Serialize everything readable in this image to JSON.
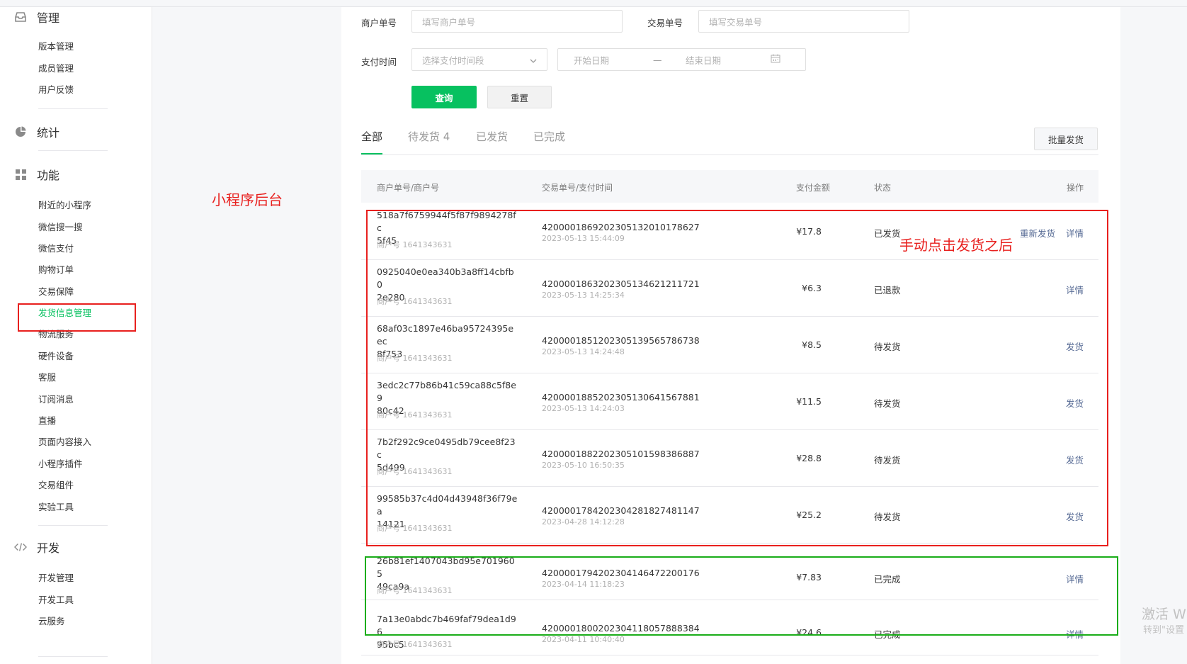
{
  "sidebar": {
    "sections": [
      {
        "title": "管理",
        "icon": "inbox-icon"
      },
      {
        "title": "统计",
        "icon": "pie-chart-icon"
      },
      {
        "title": "功能",
        "icon": "grid-icon"
      },
      {
        "title": "开发",
        "icon": "code-icon"
      }
    ],
    "manage_items": [
      "版本管理",
      "成员管理",
      "用户反馈"
    ],
    "function_items": [
      "附近的小程序",
      "微信搜一搜",
      "微信支付",
      "购物订单",
      "交易保障",
      "发货信息管理",
      "物流服务",
      "硬件设备",
      "客服",
      "订阅消息",
      "直播",
      "页面内容接入",
      "小程序插件",
      "交易组件",
      "实验工具"
    ],
    "dev_items": [
      "开发管理",
      "开发工具",
      "云服务"
    ],
    "active_item": "发货信息管理"
  },
  "filters": {
    "merchant_no_label": "商户单号",
    "merchant_no_placeholder": "填写商户单号",
    "trade_no_label": "交易单号",
    "trade_no_placeholder": "填写交易单号",
    "pay_time_label": "支付时间",
    "pay_time_placeholder": "选择支付时间段",
    "start_date": "开始日期",
    "date_sep": "—",
    "end_date": "结束日期",
    "query_button": "查询",
    "reset_button": "重置"
  },
  "tabs": [
    {
      "label": "全部",
      "active": true
    },
    {
      "label": "待发货 4",
      "active": false
    },
    {
      "label": "已发货",
      "active": false
    },
    {
      "label": "已完成",
      "active": false
    }
  ],
  "batch_ship_button": "批量发货",
  "table": {
    "headers": [
      "商户单号/商户号",
      "交易单号/支付时间",
      "支付金额",
      "状态",
      "操作"
    ],
    "rows": [
      {
        "order_line1": "518a7f6759944f5f87f9894278fc",
        "order_line2": "5f45",
        "merchant": "商户号 1641343631",
        "trade_no": "4200001869202305132010178627",
        "pay_time": "2023-05-13 15:44:09",
        "amount": "¥17.8",
        "status": "已发货",
        "actions": [
          "重新发货",
          "详情"
        ]
      },
      {
        "order_line1": "0925040e0ea340b3a8ff14cbfb0",
        "order_line2": "2e280",
        "merchant": "商户号 1641343631",
        "trade_no": "4200001863202305134621211721",
        "pay_time": "2023-05-13 14:25:34",
        "amount": "¥6.3",
        "status": "已退款",
        "actions": [
          "详情"
        ]
      },
      {
        "order_line1": "68af03c1897e46ba95724395eec",
        "order_line2": "8f753",
        "merchant": "商户号 1641343631",
        "trade_no": "4200001851202305139565786738",
        "pay_time": "2023-05-13 14:24:48",
        "amount": "¥8.5",
        "status": "待发货",
        "actions": [
          "发货"
        ]
      },
      {
        "order_line1": "3edc2c77b86b41c59ca88c5f8e9",
        "order_line2": "80c42",
        "merchant": "商户号 1641343631",
        "trade_no": "4200001885202305130641567881",
        "pay_time": "2023-05-13 14:24:03",
        "amount": "¥11.5",
        "status": "待发货",
        "actions": [
          "发货"
        ]
      },
      {
        "order_line1": "7b2f292c9ce0495db79cee8f23c",
        "order_line2": "5d499",
        "merchant": "商户号 1641343631",
        "trade_no": "4200001882202305101598386887",
        "pay_time": "2023-05-10 16:50:35",
        "amount": "¥28.8",
        "status": "待发货",
        "actions": [
          "发货"
        ]
      },
      {
        "order_line1": "99585b37c4d04d43948f36f79ea",
        "order_line2": "14121",
        "merchant": "商户号 1641343631",
        "trade_no": "4200001784202304281827481147",
        "pay_time": "2023-04-28 14:12:28",
        "amount": "¥25.2",
        "status": "待发货",
        "actions": [
          "发货"
        ]
      },
      {
        "order_line1": "26b81ef1407043bd95e7019605",
        "order_line2": "49ca9a",
        "merchant": "商户号 1641343631",
        "trade_no": "4200001794202304146472200176",
        "pay_time": "2023-04-14 11:18:23",
        "amount": "¥7.83",
        "status": "已完成",
        "actions": [
          "详情"
        ]
      },
      {
        "order_line1": "7a13e0abdc7b469faf79dea1d96",
        "order_line2": "95bc5",
        "merchant": "商户号 1641343631",
        "trade_no": "4200001800202304118057888384",
        "pay_time": "2023-04-11 10:40:40",
        "amount": "¥24.6",
        "status": "已完成",
        "actions": [
          "详情"
        ]
      }
    ]
  },
  "annotations": {
    "label_backend": "小程序后台",
    "label_after_ship": "手动点击发货之后",
    "highlight_red": "#e8201e",
    "highlight_green": "#1aad19"
  },
  "watermark": {
    "line1": "激活 W",
    "line2": "转到\"设置"
  },
  "colors": {
    "brand_green": "#07c160",
    "link_blue": "#576b95"
  }
}
